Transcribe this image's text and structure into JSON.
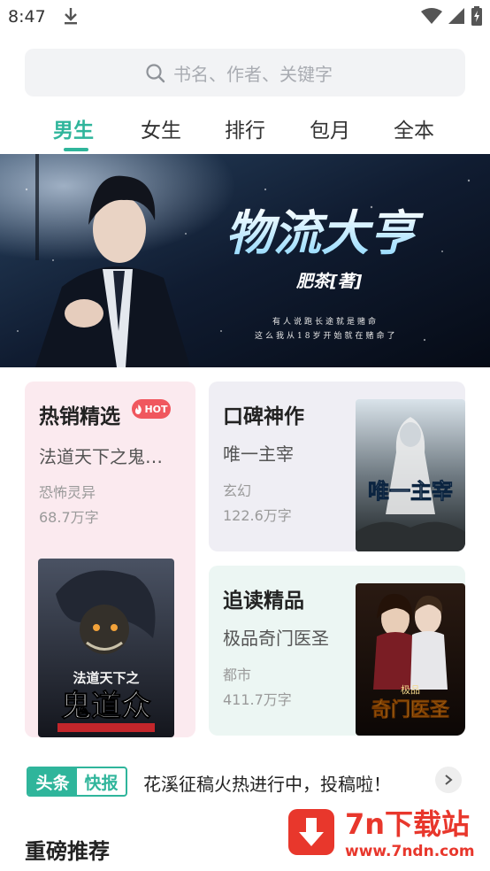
{
  "status": {
    "time": "8:47"
  },
  "search": {
    "placeholder": "书名、作者、关键字"
  },
  "tabs": [
    {
      "label": "男生",
      "active": true
    },
    {
      "label": "女生",
      "active": false
    },
    {
      "label": "排行",
      "active": false
    },
    {
      "label": "包月",
      "active": false
    },
    {
      "label": "全本",
      "active": false
    }
  ],
  "banner": {
    "logo_title": "物流大亨",
    "logo_sub": "肥茶[著]",
    "tagline_1": "有人说跑长途就是赌命",
    "tagline_2": "这么我从18岁开始就在赌命了",
    "slides": 2,
    "active_slide": 1
  },
  "cards": {
    "hot": {
      "title": "热销精选",
      "badge": "HOT",
      "book": "法道天下之鬼…",
      "genre": "恐怖灵异",
      "words": "68.7万字",
      "cover_title": "鬼道众",
      "cover_top": "法道天下之"
    },
    "koubei": {
      "title": "口碑神作",
      "book": "唯一主宰",
      "genre": "玄幻",
      "words": "122.6万字",
      "cover_title": "唯一主宰"
    },
    "zhuidu": {
      "title": "追读精品",
      "book": "极品奇门医圣",
      "genre": "都市",
      "words": "411.7万字",
      "cover_title": "奇门医圣",
      "cover_top": "极品"
    }
  },
  "news": {
    "tag_a": "头条",
    "tag_b": "快报",
    "text": "花溪征稿火热进行中，投稿啦！"
  },
  "section": {
    "title": "重磅推荐"
  },
  "watermark": {
    "title": "7n下载站",
    "url": "www.7ndn.com"
  },
  "colors": {
    "accent": "#2fb59b",
    "hot": "#f0575e",
    "watermark": "#e8372c"
  }
}
